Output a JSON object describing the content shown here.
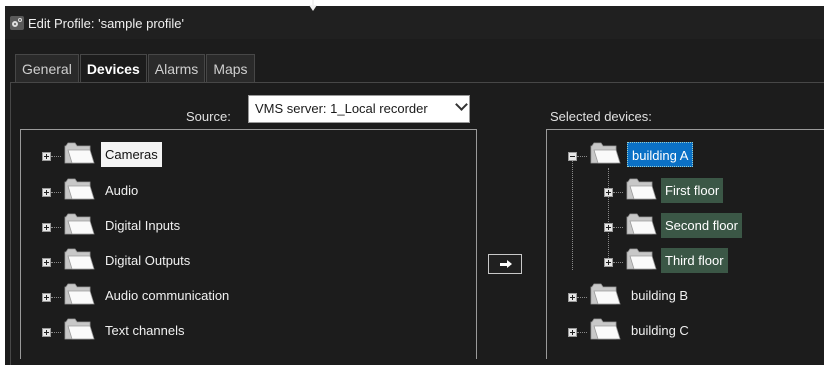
{
  "window": {
    "title": "Edit Profile: 'sample profile'"
  },
  "tabs": [
    {
      "label": "General",
      "active": false
    },
    {
      "label": "Devices",
      "active": true
    },
    {
      "label": "Alarms",
      "active": false
    },
    {
      "label": "Maps",
      "active": false
    }
  ],
  "source": {
    "label": "Source:",
    "value": "VMS server: 1_Local recorder"
  },
  "available_tree": {
    "items": [
      {
        "label": "Cameras",
        "highlight": "white"
      },
      {
        "label": "Audio"
      },
      {
        "label": "Digital Inputs"
      },
      {
        "label": "Digital Outputs"
      },
      {
        "label": "Audio communication"
      },
      {
        "label": "Text channels"
      }
    ]
  },
  "selected": {
    "label": "Selected devices:",
    "tree": [
      {
        "label": "building A",
        "expanded": true,
        "highlight": "blue",
        "children": [
          {
            "label": "First floor",
            "highlight": "green"
          },
          {
            "label": "Second floor",
            "highlight": "green"
          },
          {
            "label": "Third floor",
            "highlight": "green"
          }
        ]
      },
      {
        "label": "building B"
      },
      {
        "label": "building C"
      }
    ]
  },
  "icons": {
    "add_button": "right-arrow-icon",
    "folder": "folder-icon",
    "profile": "profile-settings-icon"
  },
  "colors": {
    "background": "#1c1c1c",
    "selection_blue": "#0b71c6",
    "selection_green": "#3b5746"
  }
}
